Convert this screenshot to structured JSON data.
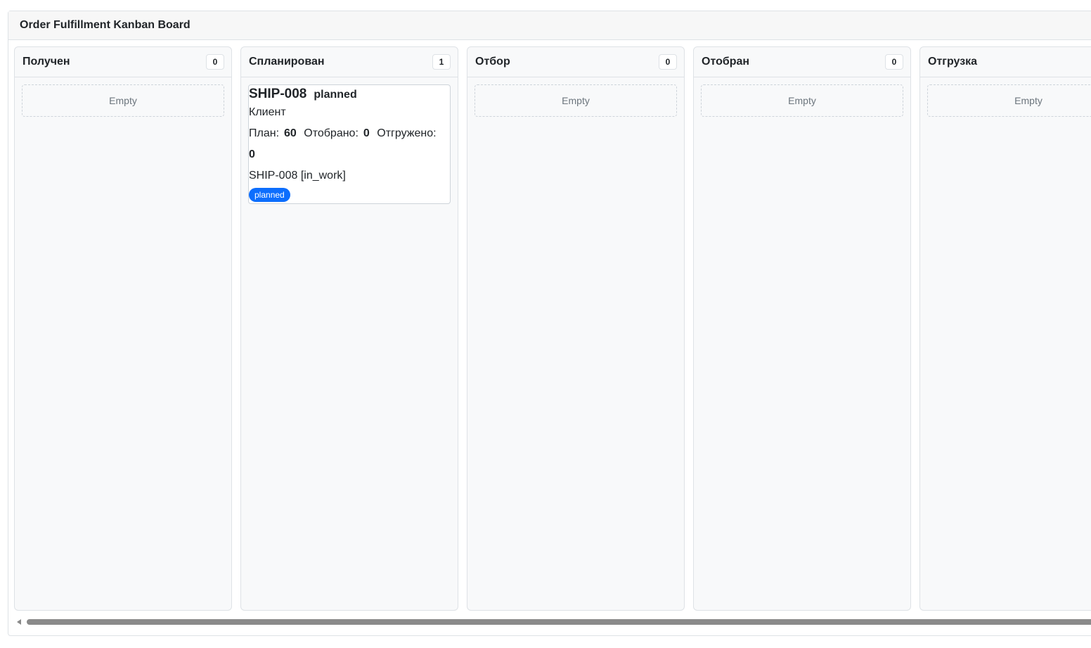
{
  "board": {
    "title": "Order Fulfillment Kanban Board"
  },
  "columns": [
    {
      "title": "Получен",
      "count": "0",
      "empty_label": "Empty"
    },
    {
      "title": "Спланирован",
      "count": "1"
    },
    {
      "title": "Отбор",
      "count": "0",
      "empty_label": "Empty"
    },
    {
      "title": "Отобран",
      "count": "0",
      "empty_label": "Empty"
    },
    {
      "title": "Отгрузка",
      "count": "",
      "empty_label": "Empty"
    }
  ],
  "card": {
    "id": "SHIP-008",
    "status_text": "planned",
    "client": "Клиент",
    "plan_label": "План:",
    "plan_value": "60",
    "picked_label": "Отобрано:",
    "picked_value": "0",
    "shipped_label": "Отгружено:",
    "shipped_value": "0",
    "reference": "SHIP-008 [in_work]",
    "badge": "planned"
  },
  "colors": {
    "badge_primary": "#0d6efd",
    "column_bg": "#f8f9fa"
  }
}
